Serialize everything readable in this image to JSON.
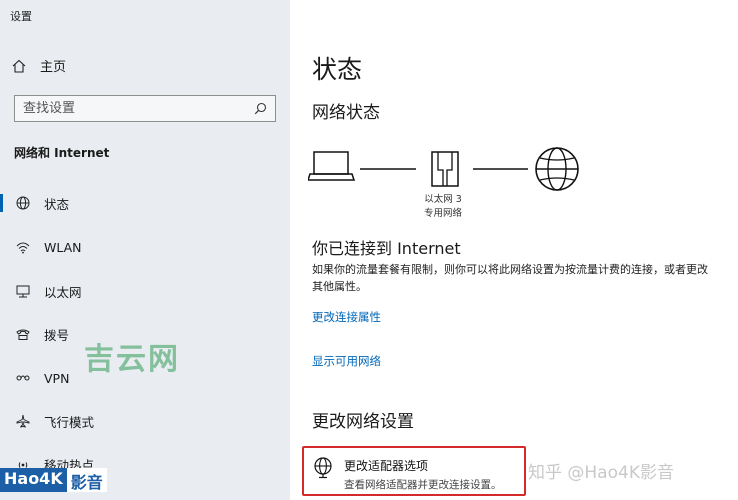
{
  "window": {
    "title": "设置"
  },
  "sidebar": {
    "home_label": "主页",
    "search_placeholder": "查找设置",
    "section_title": "网络和 Internet",
    "items": [
      {
        "label": "状态",
        "icon": "globe-icon",
        "active": true
      },
      {
        "label": "WLAN",
        "icon": "wifi-icon",
        "active": false
      },
      {
        "label": "以太网",
        "icon": "ethernet-icon",
        "active": false
      },
      {
        "label": "拨号",
        "icon": "dialup-icon",
        "active": false
      },
      {
        "label": "VPN",
        "icon": "vpn-icon",
        "active": false
      },
      {
        "label": "飞行模式",
        "icon": "airplane-icon",
        "active": false
      },
      {
        "label": "移动热点",
        "icon": "hotspot-icon",
        "active": false
      }
    ]
  },
  "main": {
    "title": "状态",
    "network_status_heading": "网络状态",
    "adapter_name": "以太网 3",
    "adapter_type": "专用网络",
    "connected_text": "你已连接到 Internet",
    "description": "如果你的流量套餐有限制，则你可以将此网络设置为按流量计费的连接，或者更改其他属性。",
    "link_change_connection_properties": "更改连接属性",
    "link_show_available_networks": "显示可用网络",
    "change_settings_heading": "更改网络设置",
    "adapter_option": {
      "title": "更改适配器选项",
      "subtitle": "查看网络适配器并更改连接设置。",
      "icon": "adapter-globe-icon"
    }
  },
  "watermarks": {
    "site_green": "吉云网",
    "badge_left": "Hao4K",
    "badge_right": "影音",
    "credit": "知乎 @Hao4K影音"
  },
  "colors": {
    "accent": "#0063b1",
    "link": "#0067b8",
    "highlight_box": "#d52a2a",
    "sidebar_bg": "#e9edf2"
  }
}
